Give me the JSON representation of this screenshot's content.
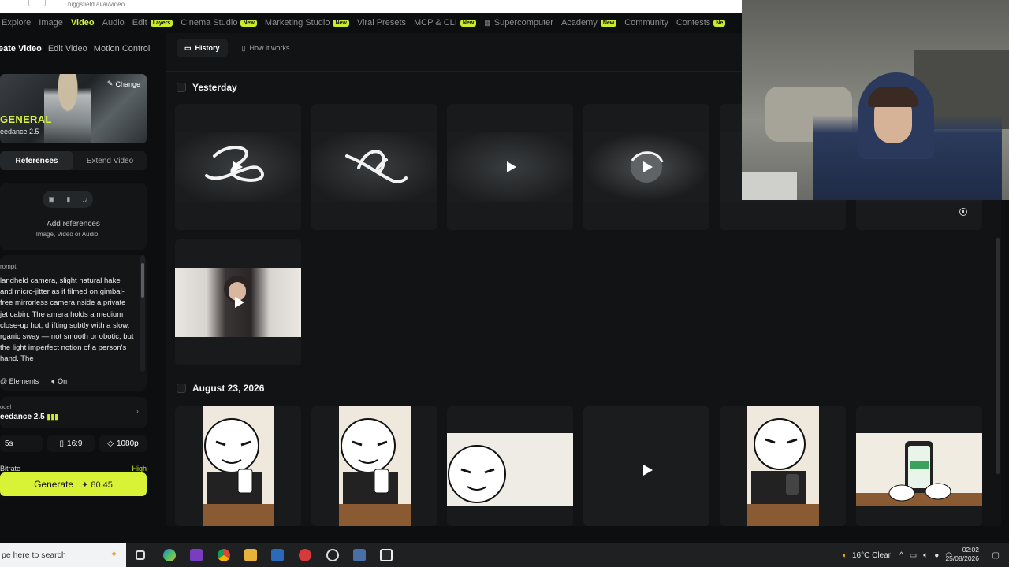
{
  "browser": {
    "url": "higgsfield.ai/ai/video"
  },
  "topnav": {
    "items": [
      {
        "label": "Explore"
      },
      {
        "label": "Image"
      },
      {
        "label": "Video"
      },
      {
        "label": "Audio"
      },
      {
        "label": "Edit",
        "badge": "Layers"
      },
      {
        "label": "Cinema Studio",
        "badge": "New"
      },
      {
        "label": "Marketing Studio",
        "badge": "New"
      },
      {
        "label": "Viral Presets"
      },
      {
        "label": "MCP & CLI",
        "badge": "New"
      },
      {
        "label": "Supercomputer"
      },
      {
        "label": "Academy",
        "badge": "New"
      },
      {
        "label": "Community"
      },
      {
        "label": "Contests",
        "badge": "Ne"
      }
    ]
  },
  "left": {
    "subtabs": [
      "eate Video",
      "Edit Video",
      "Motion Control"
    ],
    "preset": {
      "change": "Change",
      "name": "GENERAL",
      "model": "eedance 2.5"
    },
    "reftabs": [
      "References",
      "Extend Video"
    ],
    "refs": {
      "title": "Add references",
      "subtitle": "Image, Video or Audio"
    },
    "prompt": {
      "label": "rompt",
      "text": "landheld camera, slight natural hake and micro-jitter as if filmed on gimbal-free mirrorless camera nside a private jet cabin. The amera holds a medium close-up hot, drifting subtly with a slow, rganic sway — not smooth or obotic, but the light imperfect notion of a person's hand. The",
      "elements": "Elements",
      "audio": "On"
    },
    "model": {
      "label": "odel",
      "value": "eedance 2.5"
    },
    "options": {
      "duration": "5s",
      "aspect": "16:9",
      "quality": "1080p"
    },
    "bitrate": {
      "label": "Bitrate",
      "value": "High"
    },
    "generate": {
      "label": "Generate",
      "cost": "80.45"
    }
  },
  "main": {
    "tabs": [
      "History",
      "How it works"
    ],
    "sections": [
      "Yesterday",
      "August 23, 2026"
    ]
  },
  "taskbar": {
    "search": "pe here to search",
    "weather": "16°C  Clear",
    "time": "02:02",
    "date": "25/08/2026"
  },
  "colors": {
    "accent": "#d8f336",
    "bg": "#0d0e0f"
  }
}
